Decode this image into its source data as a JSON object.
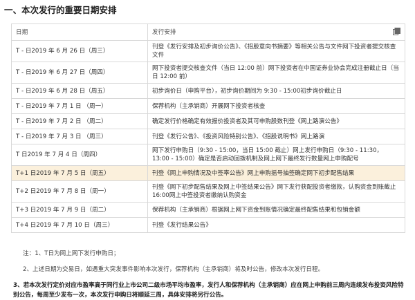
{
  "section_title": "一、本次发行的重要日期安排",
  "table": {
    "headers": [
      "日期",
      "发行安排"
    ],
    "rows": [
      {
        "date": "T - 日2019 年 6 月 26 日（周三）",
        "plan": "刊登《发行安排及初步询价公告》、《招股意向书摘要》等相关公告与文件网下投资者提交核查文件"
      },
      {
        "date": "T - 日2019 年 6 月 27 日（周四）",
        "plan": "网下投资者提交核查文件（当日 12:00 前）网下投资者在中国证券业协会完成注册截止日（当日 12:00 前）"
      },
      {
        "date": "T - 日2019 年 6 月 28 日（周五）",
        "plan": "初步询价日（申购平台），初步询价期间为 9:30 - 15:00初步询价截止日"
      },
      {
        "date": "T - 日2019 年 7 月 1 日 （周一）",
        "plan": "保荐机构（主承销商）开展网下投资者核查"
      },
      {
        "date": "T - 日2019 年 7 月 2 日 （周二）",
        "plan": "确定发行价格确定有效报价投资者及其可申购股数刊登《网上路演公告》"
      },
      {
        "date": "T - 日2019 年 7 月 3 日 （周三）",
        "plan": "刊登《发行公告》、《投资风险特别公告》、《招股说明书》网上路演"
      },
      {
        "date": "T 日2019 年 7 月 4 日（周四）",
        "plan": "网下发行申购日（9:30 - 15:00，当日 15:00 截止）网上发行申购日（9:30 - 11:30， 13:00 - 15:00）确定是否启动回拨机制及网上网下最终发行数量网上申购配号"
      },
      {
        "date": "T+1 日2019 年 7 月 5 日（周五）",
        "plan": "刊登《网上申购情况及中签率公告》网上申购摇号抽签确定网下初步配售结果"
      },
      {
        "date": "T+2 日2019 年 7 月 8 日（周一）",
        "plan": "刊登《网下初步配售结果及网上中签结果公告》网下发行获配投资者缴款，认购资金到账截止 16:00网上中签投资者缴纳认购资金"
      },
      {
        "date": "T+3 日2019 年 7 月 9 日（周二）",
        "plan": "保荐机构（主承销商）根据网上网下资金到账情况确定最终配售结果和包销金额"
      },
      {
        "date": "T+4 日2019 年 7 月 10 日（周三）",
        "plan": "刊登《发行结果公告》"
      }
    ]
  },
  "notes": {
    "n1": "注：1、T日为网上网下发行申购日；",
    "n2": "2、上述日期为交易日，如遇重大突发事件影响本次发行，保荐机构（主承销商）将及时公告，修改本次发行日程。",
    "n3": "3、若本次发行定价对应市盈率高于同行业上市公司二级市场平均市盈率，发行人和保荐机构（主承销商）应在网上申购前三周内连续发布投资风险特别公告，每周至少发布一次，本次发行申购日将顺延三周，具体安排将另行公告。"
  },
  "icons": {
    "copy": "copy-icon"
  },
  "colors": {
    "highlight_row": "#fbf0dc",
    "border": "#d8d8d8"
  }
}
